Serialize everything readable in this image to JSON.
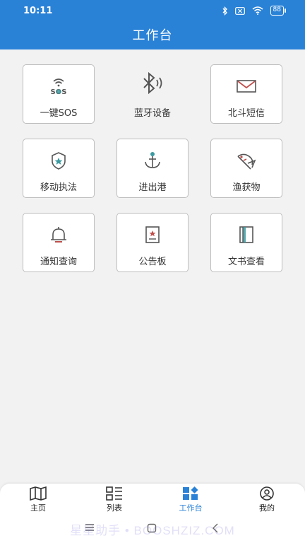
{
  "status": {
    "time": "10:11",
    "battery": "88"
  },
  "header": {
    "title": "工作台"
  },
  "tiles": [
    {
      "label": "一键SOS",
      "icon": "sos-icon",
      "logo_text": "SOS"
    },
    {
      "label": "蓝牙设备",
      "icon": "bluetooth-icon"
    },
    {
      "label": "北斗短信",
      "icon": "envelope-icon"
    },
    {
      "label": "移动执法",
      "icon": "badge-shield-icon"
    },
    {
      "label": "进出港",
      "icon": "anchor-icon"
    },
    {
      "label": "渔获物",
      "icon": "fish-icon"
    },
    {
      "label": "通知查询",
      "icon": "bell-icon"
    },
    {
      "label": "公告板",
      "icon": "notice-board-icon"
    },
    {
      "label": "文书查看",
      "icon": "document-icon"
    }
  ],
  "bottom_nav": {
    "items": [
      {
        "label": "主页",
        "icon": "map-icon"
      },
      {
        "label": "列表",
        "icon": "list-icon"
      },
      {
        "label": "工作台",
        "icon": "dashboard-icon",
        "active": true
      },
      {
        "label": "我的",
        "icon": "user-icon"
      }
    ]
  },
  "watermark": "星星助手 • BOOSHZIZ.COM",
  "colors": {
    "primary": "#2a82d7",
    "background": "#f2f2f2",
    "accent_red": "#c0504d",
    "accent_teal": "#3a9aa0"
  }
}
